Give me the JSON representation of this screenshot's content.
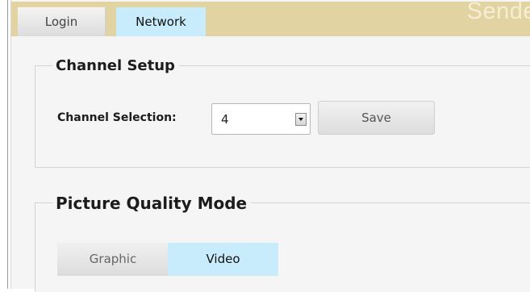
{
  "tabs": [
    {
      "label": "Login",
      "active": false
    },
    {
      "label": "Network",
      "active": true
    }
  ],
  "brand": "Sende",
  "colors": {
    "tabbar_bg": "#e2d3a3",
    "active_tab": "#c9ecfc",
    "panel_bg": "#f5f5f5"
  },
  "channel_setup": {
    "legend": "Channel Setup",
    "label": "Channel Selection:",
    "selected_value": "4",
    "save_label": "Save"
  },
  "picture_quality": {
    "legend": "Picture Quality Mode",
    "options": [
      {
        "label": "Graphic",
        "selected": false
      },
      {
        "label": "Video",
        "selected": true
      }
    ]
  }
}
